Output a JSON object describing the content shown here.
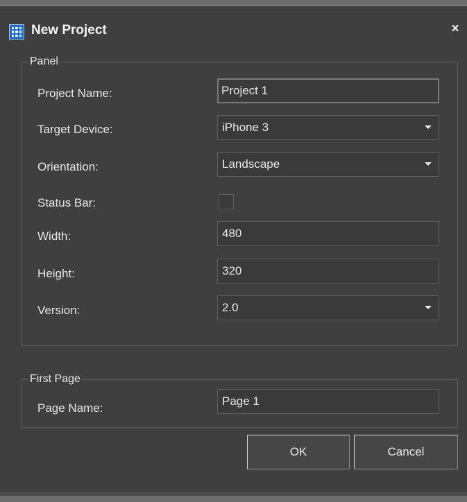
{
  "window": {
    "title": "New Project",
    "icon": "grid-app-icon",
    "close_glyph": "×"
  },
  "panel": {
    "legend": "Panel",
    "rows": [
      {
        "label": "Project Name:",
        "value": "Project 1"
      },
      {
        "label": "Target Device:",
        "value": "iPhone 3"
      },
      {
        "label": "Orientation:",
        "value": "Landscape"
      },
      {
        "label": "Status Bar:",
        "checked": false
      },
      {
        "label": "Width:",
        "value": "480"
      },
      {
        "label": "Height:",
        "value": "320"
      },
      {
        "label": "Version:",
        "value": "2.0"
      }
    ]
  },
  "first_page": {
    "legend": "First Page",
    "page_name_label": "Page Name:",
    "page_name_value": "Page 1"
  },
  "buttons": {
    "ok": "OK",
    "cancel": "Cancel"
  }
}
